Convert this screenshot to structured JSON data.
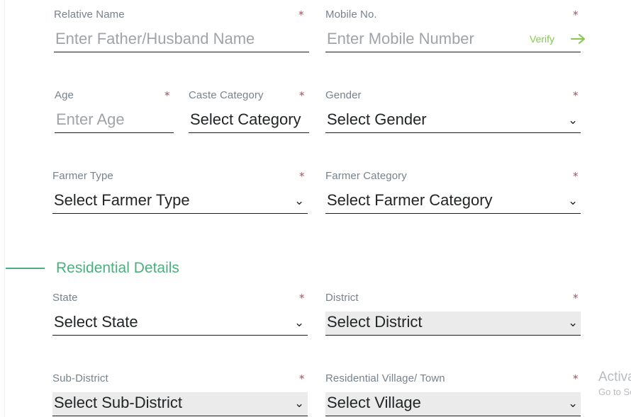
{
  "form": {
    "required_marker": "*",
    "accent_green": "#4caf7d",
    "verify_green": "#86c84f",
    "required_red": "#b5485d",
    "disabled_bg": "#ebebeb",
    "fields": [
      {
        "key": "relative_name",
        "label": "Relative Name",
        "placeholder": "Enter Father/Husband Name",
        "type": "text",
        "required": true,
        "value": ""
      },
      {
        "key": "mobile_no",
        "label": "Mobile No.",
        "placeholder": "Enter Mobile Number",
        "type": "text",
        "required": true,
        "value": "",
        "verify_label": "Verify"
      },
      {
        "key": "age",
        "label": "Age",
        "placeholder": "Enter Age",
        "type": "text",
        "required": true,
        "value": ""
      },
      {
        "key": "caste_category",
        "label": "Caste Category",
        "placeholder": "Select Category",
        "type": "select",
        "required": true,
        "value": "Select Category",
        "clipped": true
      },
      {
        "key": "gender",
        "label": "Gender",
        "placeholder": "Select Gender",
        "type": "select",
        "required": true,
        "value": "Select Gender"
      },
      {
        "key": "farmer_type",
        "label": "Farmer Type",
        "placeholder": "Select Farmer Type",
        "type": "select",
        "required": true,
        "value": "Select Farmer Type"
      },
      {
        "key": "farmer_category",
        "label": "Farmer Category",
        "placeholder": "Select Farmer Category",
        "type": "select",
        "required": true,
        "value": "Select Farmer Category"
      },
      {
        "key": "state",
        "label": "State",
        "placeholder": "Select State",
        "type": "select",
        "required": true,
        "value": "Select State"
      },
      {
        "key": "district",
        "label": "District",
        "placeholder": "Select District",
        "type": "select",
        "required": true,
        "value": "Select District",
        "shaded": true
      },
      {
        "key": "sub_district",
        "label": "Sub-District",
        "placeholder": "Select Sub-District",
        "type": "select",
        "required": true,
        "value": "Select Sub-District",
        "shaded": true
      },
      {
        "key": "village",
        "label": "Residential Village/ Town",
        "placeholder": "Select Village",
        "type": "select",
        "required": true,
        "value": "Select Village",
        "shaded": true
      }
    ],
    "section": {
      "residential_details_title": "Residential Details"
    },
    "chevron_glyph": "⌄"
  },
  "watermark": {
    "title": "Activate Windows",
    "subtitle": "Go to Settings to activate Windows."
  }
}
